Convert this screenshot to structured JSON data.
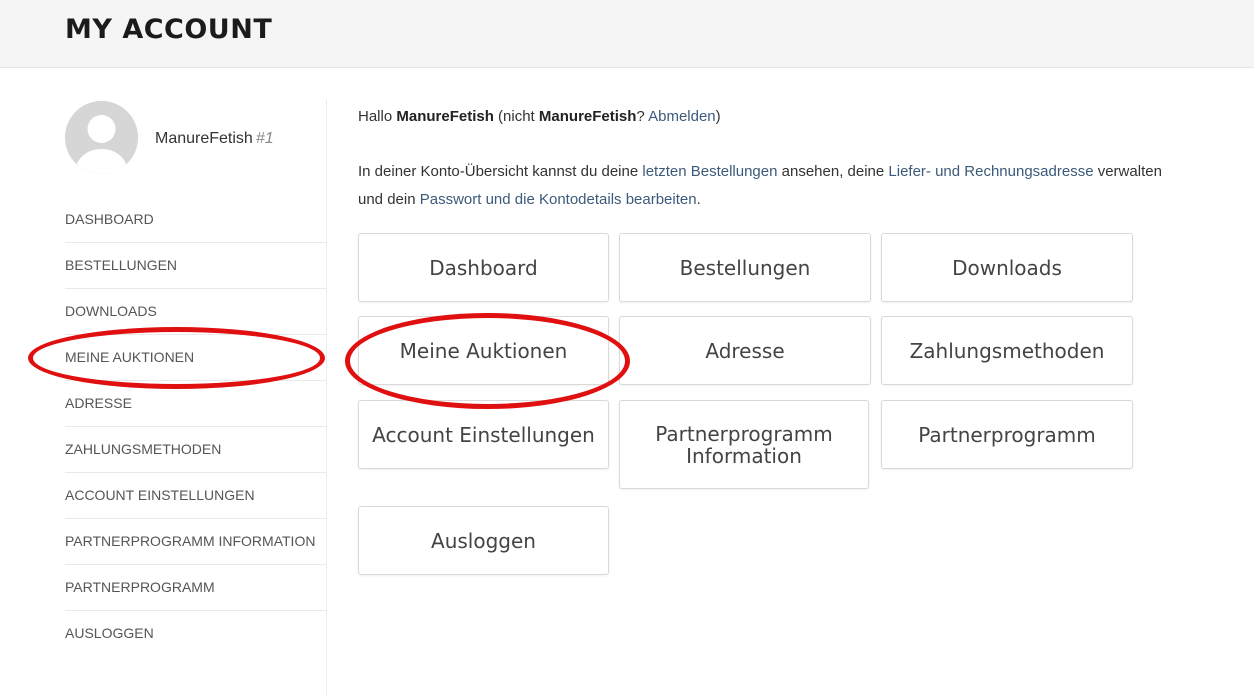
{
  "header": {
    "title": "MY ACCOUNT"
  },
  "user": {
    "name": "ManureFetish",
    "id": "#1"
  },
  "sidebar": {
    "items": [
      {
        "label": "DASHBOARD"
      },
      {
        "label": "BESTELLUNGEN"
      },
      {
        "label": "DOWNLOADS"
      },
      {
        "label": "MEINE AUKTIONEN"
      },
      {
        "label": "ADRESSE"
      },
      {
        "label": "ZAHLUNGSMETHODEN"
      },
      {
        "label": "ACCOUNT EINSTELLUNGEN"
      },
      {
        "label": "PARTNERPROGRAMM INFORMATION"
      },
      {
        "label": "PARTNERPROGRAMM"
      },
      {
        "label": "AUSLOGGEN"
      }
    ]
  },
  "greeting": {
    "hello": "Hallo",
    "name1": "ManureFetish",
    "not_open": "(nicht",
    "name2": "ManureFetish",
    "question": "?",
    "logout_link": "Abmelden",
    "close": ")"
  },
  "intro": {
    "part1": "In deiner Konto-Übersicht kannst du deine",
    "link1": "letzten Bestellungen",
    "part2": "ansehen, deine",
    "link2": "Liefer- und Rechnungsadresse",
    "part3": "verwalten und dein",
    "link3": "Passwort und die Kontodetails bearbeiten",
    "part4": "."
  },
  "tiles": [
    {
      "label": "Dashboard"
    },
    {
      "label": "Bestellungen"
    },
    {
      "label": "Downloads"
    },
    {
      "label": "Meine Auktionen"
    },
    {
      "label": "Adresse"
    },
    {
      "label": "Zahlungsmethoden"
    },
    {
      "label": "Account Einstellungen"
    },
    {
      "label": "Partnerprogramm Information"
    },
    {
      "label": "Partnerprogramm"
    },
    {
      "label": "Ausloggen"
    }
  ],
  "colors": {
    "annotation": "#e01010",
    "link": "#3c5a7a"
  }
}
